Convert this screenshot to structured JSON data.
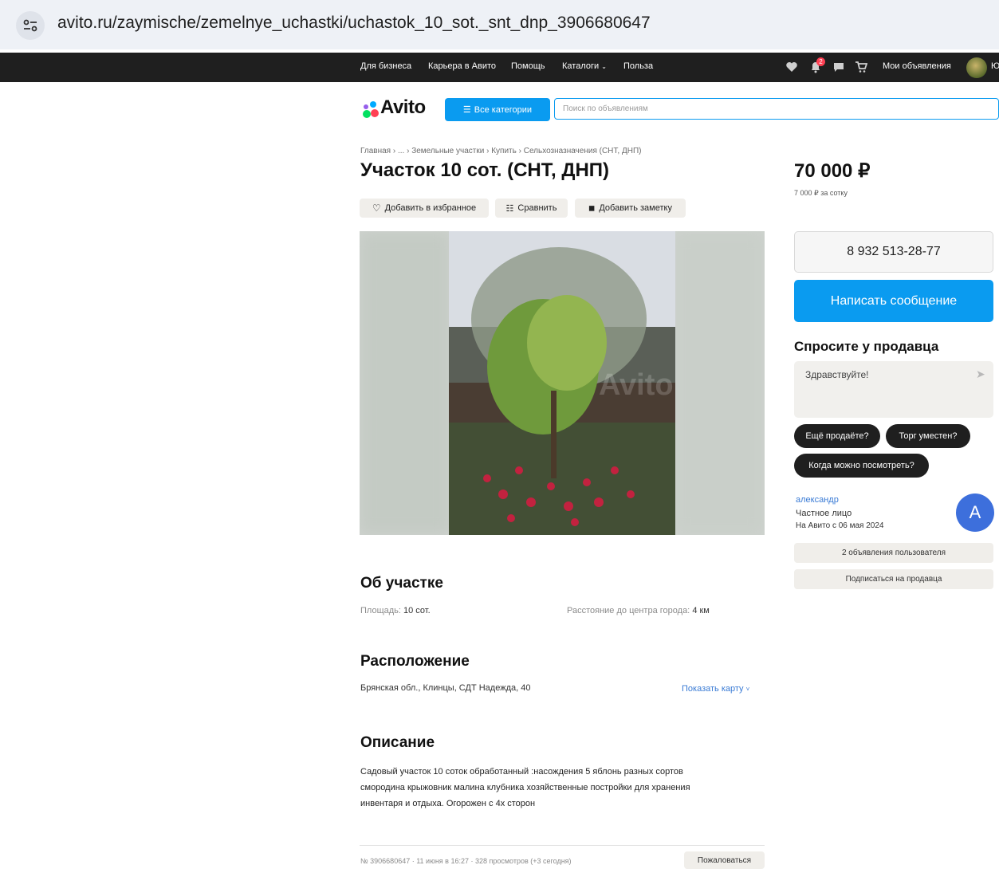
{
  "browser": {
    "url": "avito.ru/zaymische/zemelnye_uchastki/uchastok_10_sot._snt_dnp_3906680647"
  },
  "topnav": {
    "links": [
      "Для бизнеса",
      "Карьера в Авито",
      "Помощь",
      "Каталоги",
      "Польза"
    ],
    "my_ads": "Мои объявления",
    "notif_count": "2"
  },
  "header": {
    "logo": "Avito",
    "categories_button": "Все категории",
    "search_placeholder": "Поиск по объявлениям"
  },
  "breadcrumb": [
    "Главная",
    "...",
    "Земельные участки",
    "Купить",
    "Сельхозназначения (СНТ, ДНП)"
  ],
  "listing": {
    "title": "Участок 10 сот. (СНТ, ДНП)",
    "actions": [
      "Добавить в избранное",
      "Сравнить",
      "Добавить заметку"
    ],
    "photo_watermark": "Avito"
  },
  "about": {
    "heading": "Об участке",
    "area_label": "Площадь:",
    "area_value": "10 сот.",
    "distance_label": "Расстояние до центра города:",
    "distance_value": "4 км"
  },
  "location": {
    "heading": "Расположение",
    "address": "Брянская обл., Клинцы, СДТ Надежда, 40",
    "show_map": "Показать карту"
  },
  "description": {
    "heading": "Описание",
    "lines": [
      "Садовый участок 10 соток обработанный :насождения 5 яблонь разных сортов",
      "смородина крыжовник малина клубника хозяйственные постройки для хранения",
      "инвентаря и отдыха. Огорожен с 4х сторон"
    ]
  },
  "footer": {
    "meta": "№ 3906680647 · 11 июня в 16:27 · 328 просмотров (+3 сегодня)",
    "report": "Пожаловаться"
  },
  "sidebar": {
    "price": "70 000 ₽",
    "price_per": "7 000 ₽ за сотку",
    "phone": "8 932 513-28-77",
    "message_button": "Написать сообщение",
    "ask_title": "Спросите у продавца",
    "ask_value": "Здравствуйте!",
    "quick_replies": [
      "Ещё продаёте?",
      "Торг уместен?",
      "Когда можно посмотреть?"
    ],
    "seller": {
      "name": "александр",
      "type": "Частное лицо",
      "since": "На Авито с 06 мая 2024",
      "avatar_letter": "А"
    },
    "user_ads": "2 объявления пользователя",
    "subscribe": "Подписаться на продавца"
  },
  "colors": {
    "accent": "#0a9bf0",
    "dark": "#1f1f1f",
    "link": "#3a7bd5"
  }
}
